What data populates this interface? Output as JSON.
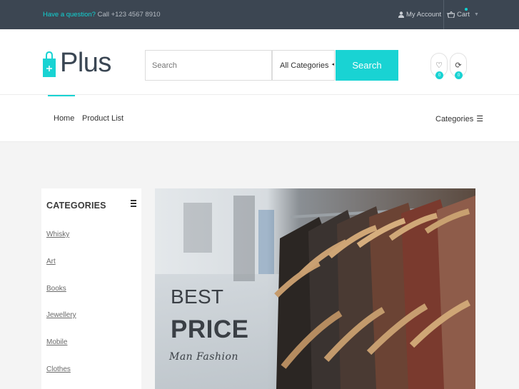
{
  "topbar": {
    "question": "Have a question?",
    "phone": "Call +123 4567 8910",
    "account": "My Account",
    "cart": "Cart"
  },
  "header": {
    "logo": "Plus",
    "search_placeholder": "Search",
    "category_select": "All Categories",
    "search_button": "Search",
    "wishlist_count": "0",
    "compare_count": "0"
  },
  "nav": {
    "home": "Home",
    "product_list": "Product List",
    "categories": "Categories"
  },
  "sidebar": {
    "title": "CATEGORIES",
    "items": [
      "Whisky",
      "Art",
      "Books",
      "Jewellery",
      "Mobile",
      "Clothes"
    ]
  },
  "banner": {
    "line1": "BEST",
    "line2": "PRICE",
    "line3": "Man Fashion"
  },
  "colors": {
    "accent": "#19d3d3",
    "topbar": "#3c4652"
  }
}
